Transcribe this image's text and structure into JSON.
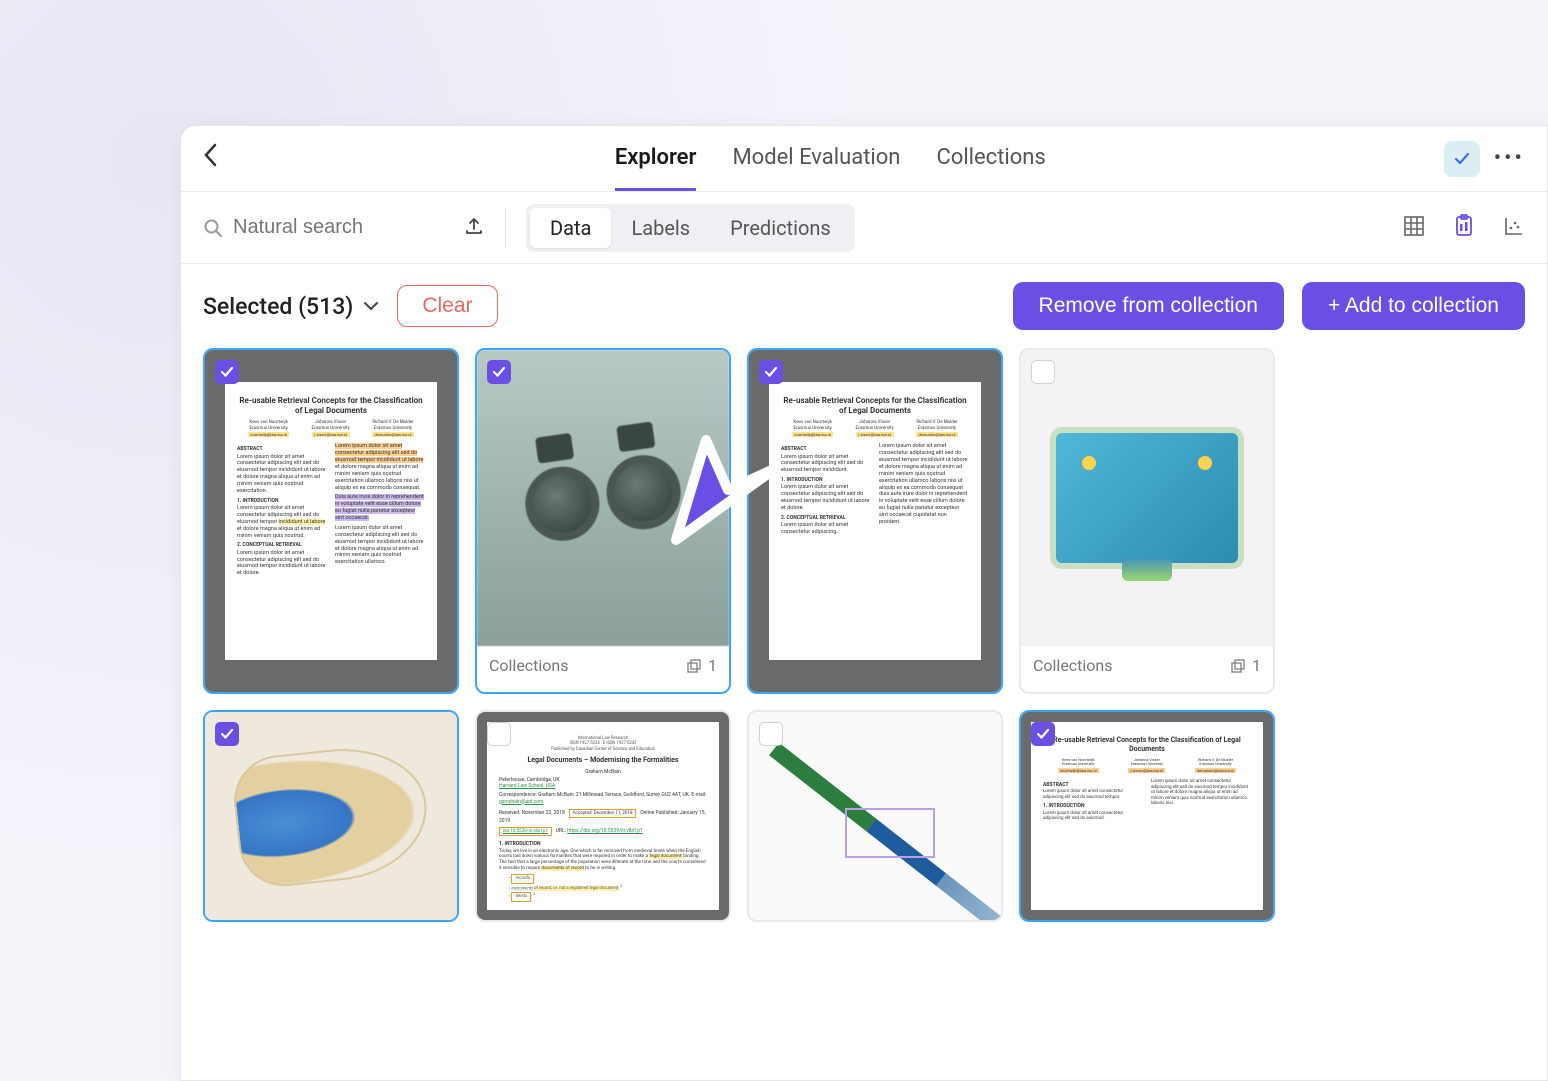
{
  "nav": {
    "tabs": [
      "Explorer",
      "Model Evaluation",
      "Collections"
    ],
    "active_tab": 0
  },
  "search": {
    "placeholder": "Natural search"
  },
  "segments": {
    "items": [
      "Data",
      "Labels",
      "Predictions"
    ],
    "active": 0
  },
  "selection": {
    "label": "Selected (513)",
    "clear": "Clear"
  },
  "actions": {
    "remove": "Remove from collection",
    "add": "+ Add to collection"
  },
  "doc": {
    "title": "Re-usable Retrieval Concepts for the Classification of Legal Documents",
    "authors": [
      {
        "name": "Kees van Noortwijk",
        "affil": "Erasmus University",
        "email": "noortwijk@law.eur.nl"
      },
      {
        "name": "Johanna Visser",
        "affil": "Erasmus University",
        "email": "j.visser@law.eur.nl"
      },
      {
        "name": "Richard V. De Mulder",
        "affil": "Erasmus University",
        "email": "demulder@law.eur.nl"
      }
    ],
    "sections": {
      "abstract": "ABSTRACT",
      "intro": "1. INTRODUCTION",
      "conceptual": "2. CONCEPTUAL RETRIEVAL"
    }
  },
  "doc2": {
    "title": "Legal Documents – Modernising the Formalities",
    "author": "Graham McBain",
    "affil": "Peterhouse, Cambridge, UK",
    "received": "Received: November 22, 2018",
    "accepted": "Accepted: December 11, 2018",
    "published": "Online Published: January 15, 2019",
    "intro": "1. INTRODUCTION"
  },
  "card_meta": {
    "collections_label": "Collections",
    "count": "1"
  },
  "cards": [
    {
      "selected": true,
      "type": "doc",
      "has_meta": false
    },
    {
      "selected": true,
      "type": "binoculars",
      "has_meta": true
    },
    {
      "selected": true,
      "type": "doc",
      "has_meta": false
    },
    {
      "selected": false,
      "type": "xray_camera",
      "has_meta": true
    },
    {
      "selected": true,
      "type": "xray_shoe",
      "has_meta": false
    },
    {
      "selected": false,
      "type": "doc2",
      "has_meta": false
    },
    {
      "selected": false,
      "type": "xray_knife",
      "has_meta": false
    },
    {
      "selected": true,
      "type": "doc",
      "has_meta": false
    }
  ]
}
